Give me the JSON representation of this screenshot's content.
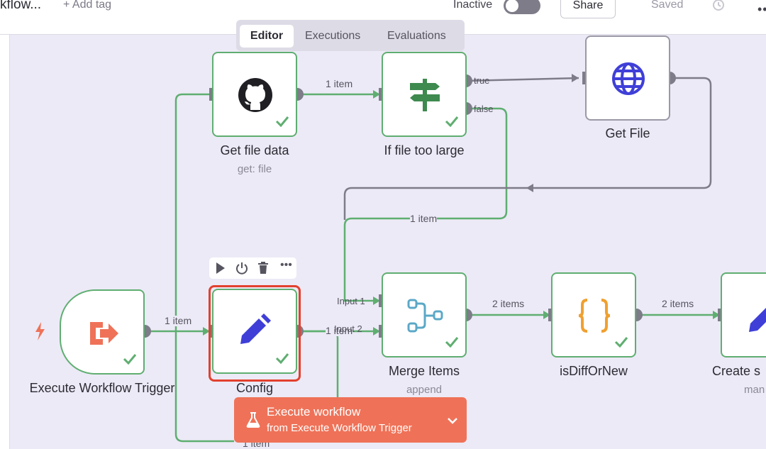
{
  "header": {
    "workflow_name": "kflow...",
    "add_tag": "+ Add tag",
    "status_label": "Inactive",
    "share_label": "Share",
    "saved_label": "Saved"
  },
  "tabs": [
    {
      "label": "Editor",
      "active": true
    },
    {
      "label": "Executions",
      "active": false
    },
    {
      "label": "Evaluations",
      "active": false
    }
  ],
  "nodes": {
    "trigger": {
      "label": "Execute Workflow Trigger"
    },
    "config": {
      "label": "Config"
    },
    "get_file_data": {
      "label": "Get file data",
      "subtitle": "get: file"
    },
    "if_large": {
      "label": "If file too large"
    },
    "get_file": {
      "label": "Get File"
    },
    "merge": {
      "label": "Merge Items",
      "subtitle": "append"
    },
    "isdiff": {
      "label": "isDiffOrNew"
    },
    "create": {
      "label": "Create s",
      "subtitle": "man"
    }
  },
  "edges": {
    "trigger_config": "1 item",
    "config_getfile": "1 item",
    "if_merge": "1 item",
    "config_merge": "1 item",
    "config_bottom": "1 item",
    "merge_isdiff": "2 items",
    "isdiff_create": "2 items"
  },
  "ports": {
    "true": "true",
    "false": "false",
    "input1": "Input 1",
    "input2": "Input 2"
  },
  "execute_button": {
    "label": "Execute workflow",
    "sublabel": "from Execute Workflow Trigger"
  },
  "colors": {
    "success": "#5fae71",
    "accent": "#ef7258",
    "selection": "#e2412e",
    "canvas": "#eceaf6"
  },
  "icons": {
    "trigger": "sign-out-icon",
    "config": "pencil-icon",
    "get_file_data": "github-icon",
    "if_large": "signpost-icon",
    "get_file": "globe-icon",
    "merge": "merge-icon",
    "isdiff": "braces-icon",
    "create": "pencil-icon"
  }
}
